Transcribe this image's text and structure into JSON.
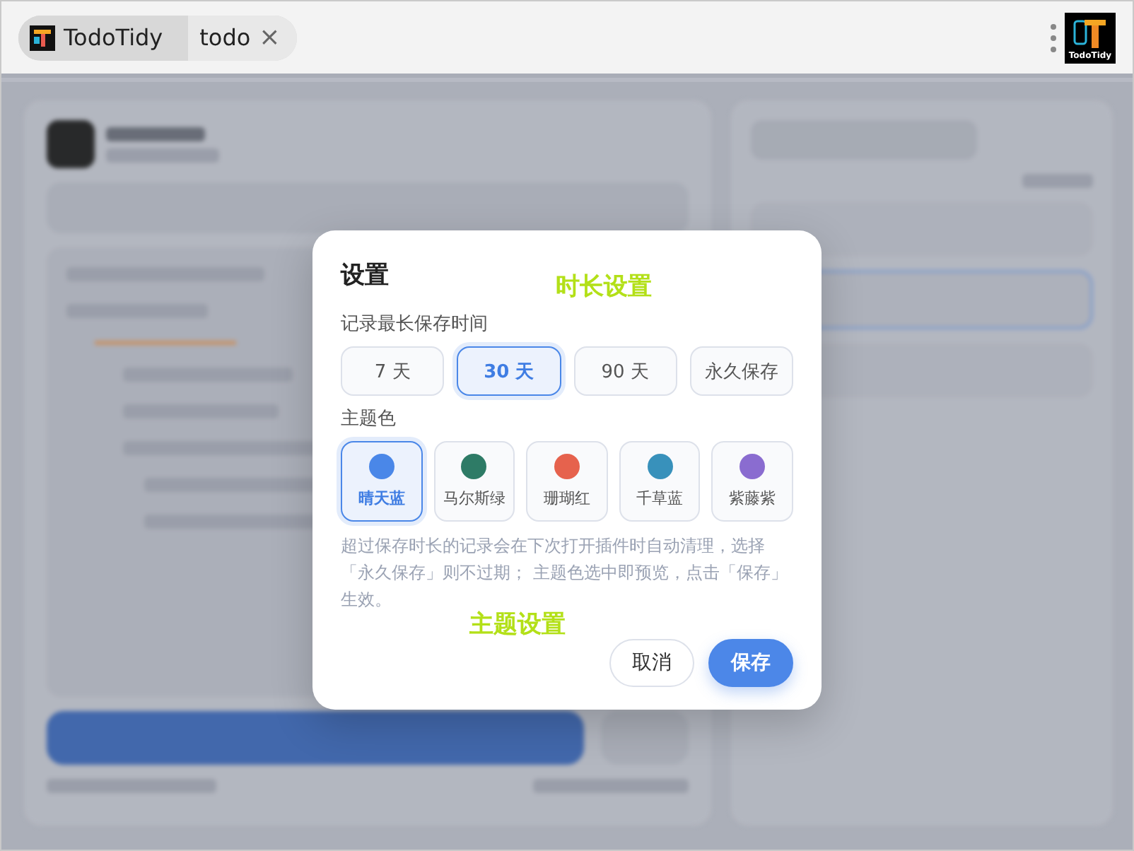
{
  "tabs": [
    {
      "label": "TodoTidy",
      "kind": "app",
      "selected": false
    },
    {
      "label": "todo",
      "kind": "page",
      "selected": true,
      "close": "×"
    }
  ],
  "logo_text": "TodoTidy",
  "dialog": {
    "title": "设置",
    "retention_label": "记录最长保存时间",
    "retention_options": [
      {
        "label": "7 天",
        "selected": false
      },
      {
        "label": "30 天",
        "selected": true
      },
      {
        "label": "90 天",
        "selected": false
      },
      {
        "label": "永久保存",
        "selected": false
      }
    ],
    "theme_label": "主题色",
    "themes": [
      {
        "label": "晴天蓝",
        "color": "#4a87e8",
        "selected": true
      },
      {
        "label": "马尔斯绿",
        "color": "#2e7b66",
        "selected": false
      },
      {
        "label": "珊瑚红",
        "color": "#e6624d",
        "selected": false
      },
      {
        "label": "千草蓝",
        "color": "#3891bb",
        "selected": false
      },
      {
        "label": "紫藤紫",
        "color": "#8a6cd0",
        "selected": false
      }
    ],
    "note": "超过保存时长的记录会在下次打开插件时自动清理，选择「永久保存」则不过期； 主题色选中即预览，点击「保存」生效。",
    "buttons": [
      {
        "label": "取消",
        "kind": "secondary"
      },
      {
        "label": "保存",
        "kind": "primary"
      }
    ]
  },
  "annotations": [
    "时长设置",
    "主题设置"
  ]
}
